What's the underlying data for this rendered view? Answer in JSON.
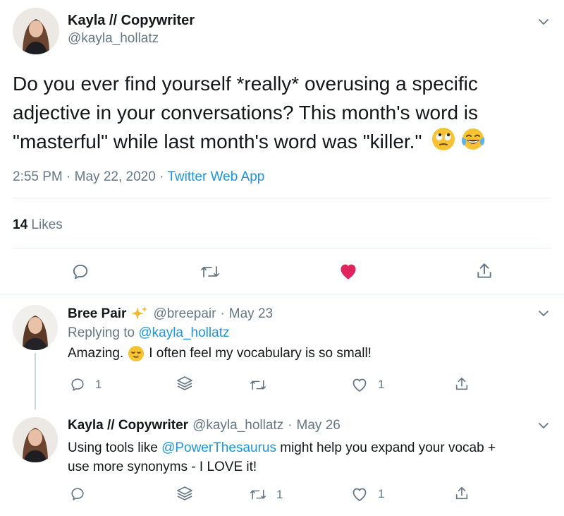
{
  "main_tweet": {
    "display_name": "Kayla // Copywriter",
    "handle": "@kayla_hollatz",
    "text_line1": "Do you ever find yourself *really* overusing a specific",
    "text_line2": "adjective in your conversations? This month's word is",
    "text_line3": "\"masterful\" while last month's word was \"killer.\"",
    "time": "2:55 PM",
    "date": "May 22, 2020",
    "source": "Twitter Web App",
    "likes_count": "14",
    "likes_label": "Likes"
  },
  "reply1": {
    "display_name": "Bree Pair",
    "handle": "@breepair",
    "date": "May 23",
    "replying_label": "Replying to",
    "replying_handle": "@kayla_hollatz",
    "text_before": "Amazing.",
    "text_after": "I often feel my vocabulary is so small!",
    "reply_count": "1",
    "like_count": "1"
  },
  "reply2": {
    "display_name": "Kayla // Copywriter",
    "handle": "@kayla_hollatz",
    "date": "May 26",
    "text_before": "Using tools like ",
    "mention": "@PowerThesaurus",
    "text_after": " might help you expand your vocab +",
    "text_line2": "use more synonyms - I LOVE it!",
    "retweet_count": "1",
    "like_count": "1"
  },
  "separator": "·",
  "colors": {
    "like_red": "#e0245e",
    "link_blue": "#1b95e0",
    "gray": "#657786"
  }
}
